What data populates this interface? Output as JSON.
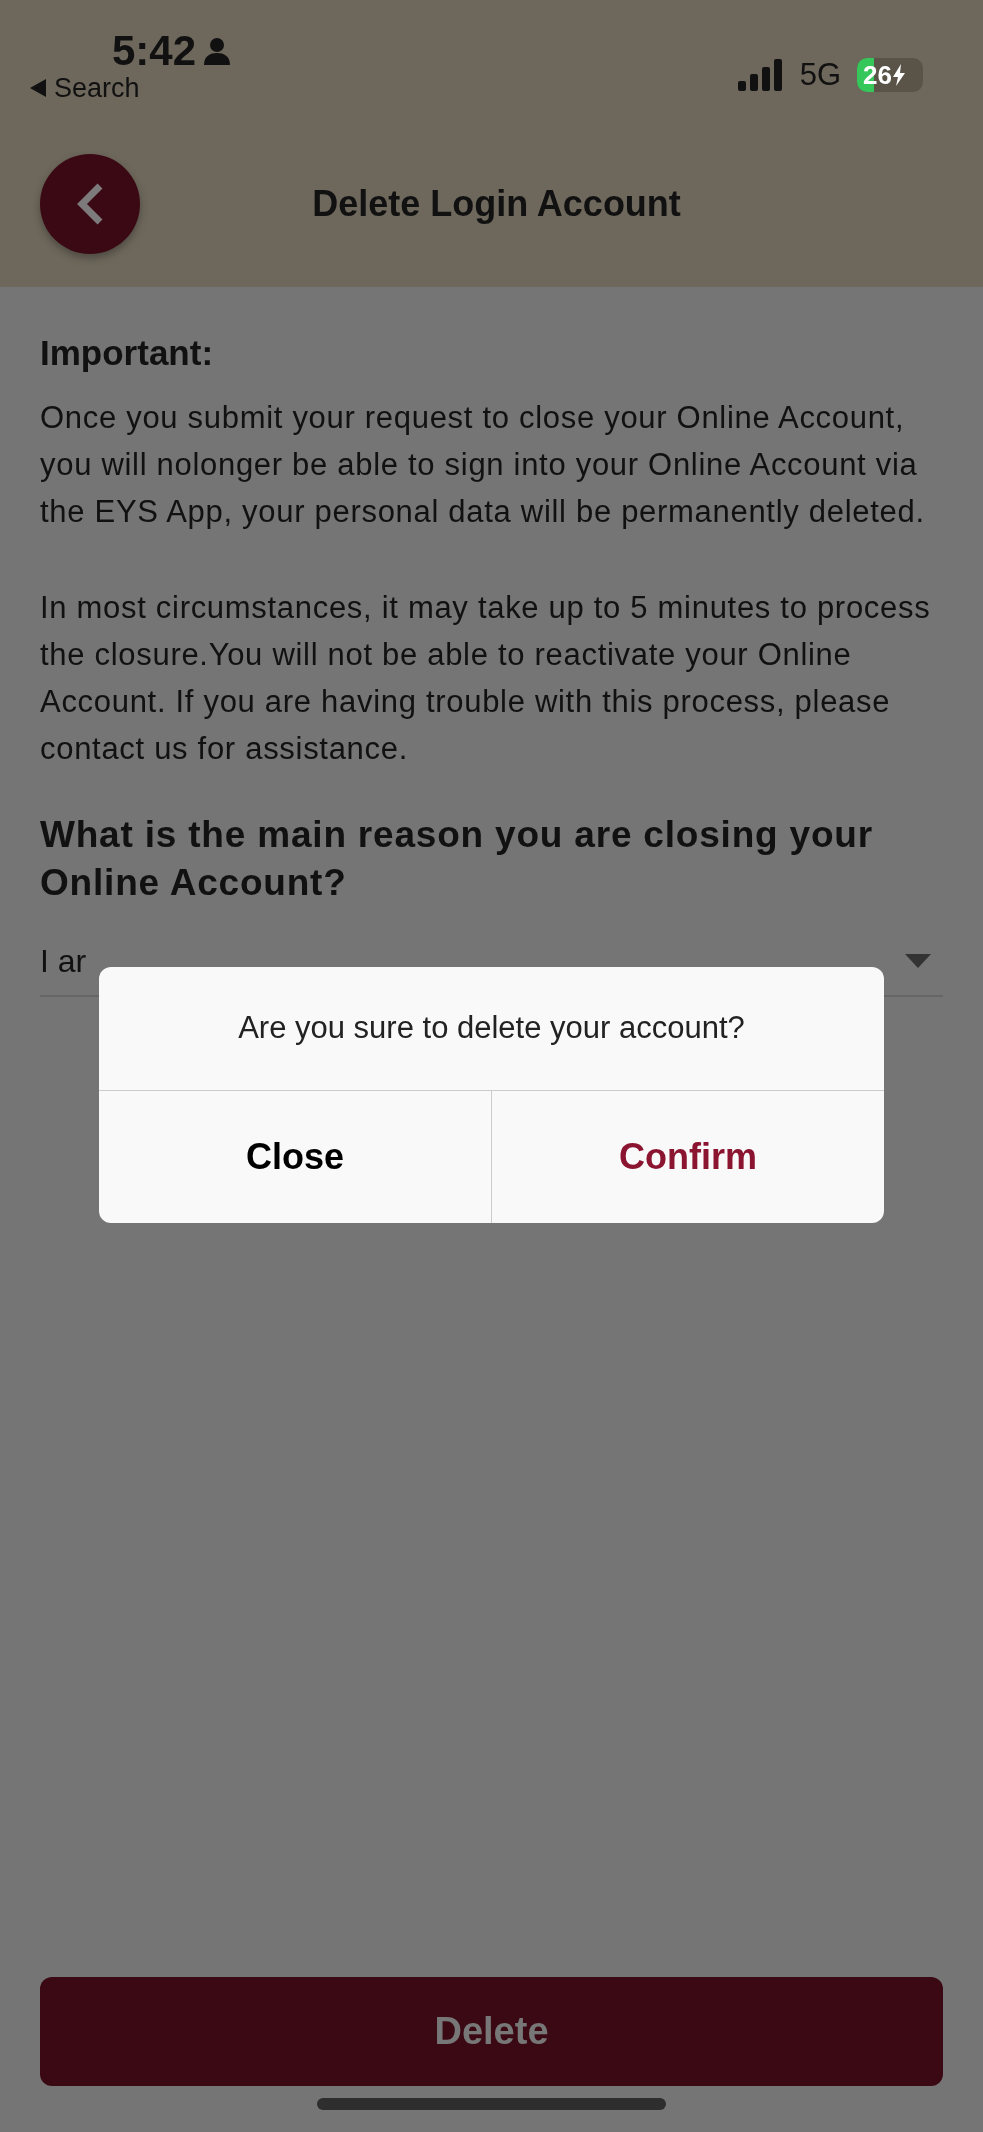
{
  "status_bar": {
    "time": "5:42",
    "back_label": "Search",
    "network": "5G",
    "battery": "26"
  },
  "header": {
    "title": "Delete Login Account"
  },
  "content": {
    "heading": "Important:",
    "paragraphs": [
      "Once you submit your request to close your Online Account, you will nolonger be able to sign into your Online Account via the EYS App, your personal data will be permanently deleted.",
      "In most circumstances, it may take up to 5 minutes to process the closure.You will not be able to reactivate your Online Account. If you are having trouble with this process, please contact us for assistance."
    ],
    "question": "What is the main reason you are closing your Online Account?",
    "reason_select": {
      "value": "I ar"
    }
  },
  "dialog": {
    "message": "Are you sure to delete your account?",
    "buttons": [
      {
        "label": "Close",
        "kind": "cancel"
      },
      {
        "label": "Confirm",
        "kind": "confirm"
      }
    ]
  },
  "delete_button": {
    "label": "Delete"
  }
}
